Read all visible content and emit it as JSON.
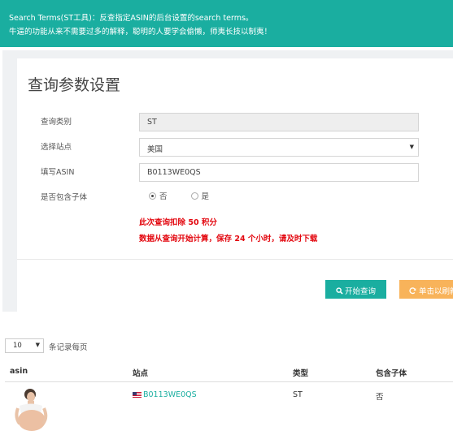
{
  "banner": {
    "line1": "Search Terms(ST工具)：反查指定ASIN的后台设置的search terms。",
    "line2": "牛逼的功能从来不需要过多的解释，聪明的人要学会偷懒，师夷长技以制夷！"
  },
  "form": {
    "title": "查询参数设置",
    "query_type_label": "查询类别",
    "query_type_value": "ST",
    "site_label": "选择站点",
    "site_value": "美国",
    "asin_label": "填写ASIN",
    "asin_value": "B0113WE0QS",
    "include_child_label": "是否包含子体",
    "include_child_options": [
      "否",
      "是"
    ],
    "include_child_selected": "否",
    "notice_cost_prefix": "此次查询扣除",
    "notice_cost_value": "50",
    "notice_cost_suffix": "积分",
    "notice_keep_prefix": "数据从查询开始计算，保存",
    "notice_keep_value": "24",
    "notice_keep_suffix": "个小时，请及时下载"
  },
  "buttons": {
    "query_icon": "search-icon",
    "query_label": "开始查询",
    "refresh_icon": "refresh-icon",
    "refresh_label": "单击以刷新"
  },
  "table": {
    "page_length": "10",
    "page_length_text": "条记录每页",
    "columns": [
      "asin",
      "站点",
      "类型",
      "包含子体"
    ],
    "rows": [
      {
        "asin_image": "product-photo",
        "site_flag": "us-flag-icon",
        "site": "B0113WE0QS",
        "type": "ST",
        "include_child": "否"
      }
    ]
  },
  "colors": {
    "accent": "#1aaea0",
    "warning": "#f8b35a",
    "notice": "#e3070f",
    "page_bg": "#eff1f3"
  }
}
